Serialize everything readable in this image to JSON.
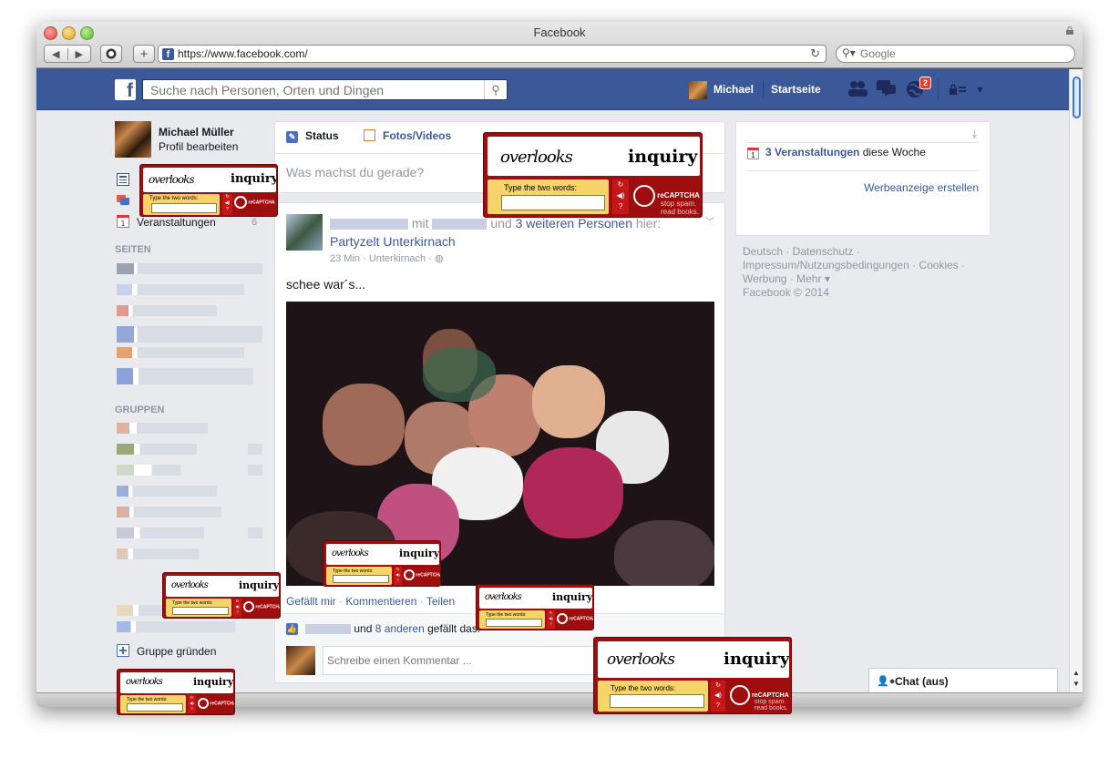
{
  "browser": {
    "window_title": "Facebook",
    "url": "https://www.facebook.com/",
    "search_placeholder": "Google",
    "back_icon": "chevron-left",
    "forward_icon": "chevron-right"
  },
  "facebook": {
    "logo": "f",
    "search_placeholder": "Suche nach Personen, Orten und Dingen",
    "user_name": "Michael",
    "home_label": "Startseite",
    "notifications_count": "2"
  },
  "sidebar": {
    "profile_name": "Michael Müller",
    "profile_edit": "Profil bearbeiten",
    "events_label": "Veranstaltungen",
    "events_count": "6",
    "pages_heading": "SEITEN",
    "groups_heading": "GRUPPEN",
    "create_group": "Gruppe gründen"
  },
  "composer": {
    "tab_status": "Status",
    "tab_photos": "Fotos/Videos",
    "placeholder": "Was machst du gerade?"
  },
  "post": {
    "with": "mit",
    "and": "und",
    "others": "3 weiteren Personen",
    "here": "hier:",
    "place": "Partyzelt Unterkirnach",
    "time": "23 Min",
    "location": "Unterkirnach",
    "text": "schee war´s...",
    "like": "Gefällt mir",
    "comment": "Kommentieren",
    "share": "Teilen",
    "likes_and": "und",
    "likes_others": "8 anderen",
    "likes_suffix": "gefällt das.",
    "comment_placeholder": "Schreibe einen Kommentar ..."
  },
  "right": {
    "events_link": "3 Veranstaltungen",
    "events_suffix": "diese Woche",
    "create_ad": "Werbeanzeige erstellen",
    "calendar_day": "1",
    "footer_line1": "Deutsch · Datenschutz ·",
    "footer_line2": "Impressum/Nutzungsbedingungen · Cookies ·",
    "footer_line3": "Werbung · Mehr ▾",
    "footer_line4": "Facebook © 2014"
  },
  "chat": {
    "label": "Chat (aus)"
  },
  "captcha": {
    "word1": "overlooks",
    "word2": "inquiry",
    "prompt": "Type the two words:",
    "brand": "reCAPTCHA",
    "tagline1": "stop spam.",
    "tagline2": "read books."
  },
  "colors": {
    "facebook_blue": "#3b5998",
    "captcha_red": "#9e0e0e",
    "notification_red": "#f03d25"
  }
}
